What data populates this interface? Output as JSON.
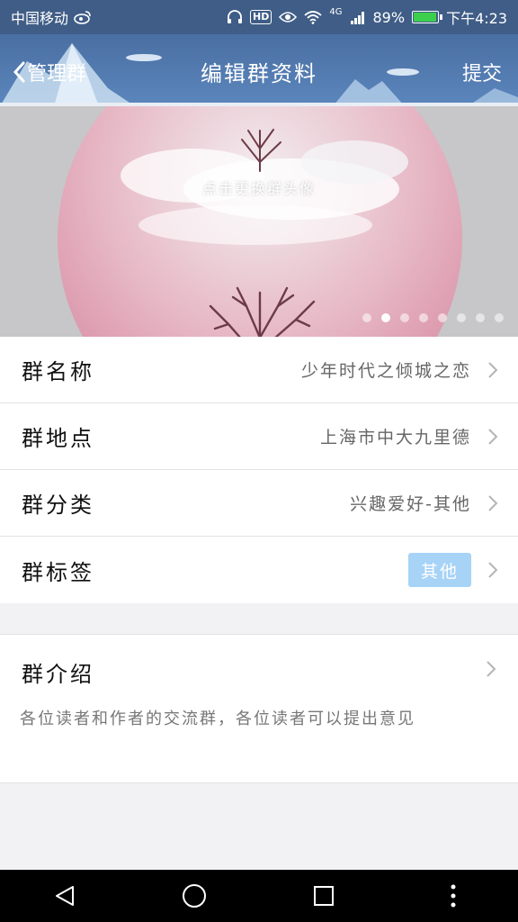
{
  "status_bar": {
    "carrier": "中国移动",
    "network": "4G",
    "battery_pct": "89%",
    "time": "下午4:23",
    "hd_label": "HD",
    "icons": [
      "weibo-icon",
      "headphones-icon",
      "eye-icon",
      "wifi-icon",
      "signal-icon",
      "battery-icon"
    ]
  },
  "header": {
    "back_label": "管理群",
    "title": "编辑群资料",
    "submit_label": "提交"
  },
  "hero": {
    "change_avatar_label": "点击更换群头像",
    "page_count": 8,
    "active_page": 2
  },
  "rows": [
    {
      "label": "群名称",
      "value": "少年时代之倾城之恋"
    },
    {
      "label": "群地点",
      "value": "上海市中大九里德"
    },
    {
      "label": "群分类",
      "value": "兴趣爱好-其他"
    },
    {
      "label": "群标签",
      "tag": "其他"
    }
  ],
  "intro": {
    "label": "群介绍",
    "text": "各位读者和作者的交流群，各位读者可以提出意见"
  },
  "nav": {
    "icons": [
      "back-icon",
      "home-icon",
      "recents-icon",
      "more-icon"
    ]
  },
  "colors": {
    "header_bg": "#4a6fa2",
    "tag_bg": "#a7d3f7"
  }
}
